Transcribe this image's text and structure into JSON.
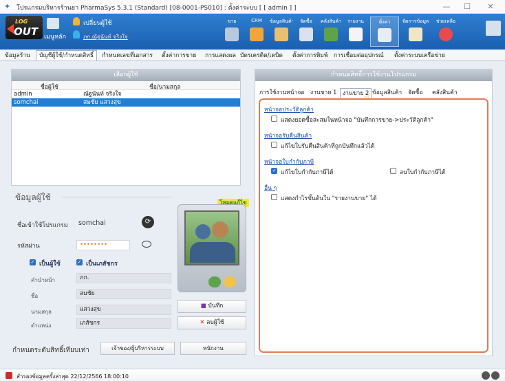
{
  "window": {
    "title": "โปรแกรมบริหารร้านยา PharmaSys 5.3.1 (Standard) [08-0001-PS010] : ตั้งค่าระบบ [ [ admin ] ]"
  },
  "toolbar": {
    "logo_top": "LOG",
    "logo_bottom": "OUT",
    "main_menu": "เมนูหลัก",
    "switch_user": "เปลี่ยนผู้ใช้",
    "user_name": "ภก.ณัฐนันท์ จริงใจ",
    "buttons": [
      "ขาย",
      "CRM",
      "ข้อมูลสินค้า",
      "จัดซื้อ",
      "คลังสินค้า",
      "รายงาน",
      "ตั้งค่า",
      "จัดการข้อมูล",
      "ช่วยเหลือ"
    ]
  },
  "menubar": {
    "items": [
      "ข้อมูลร้าน",
      "บัญชีผู้ใช้/กำหนดสิทธิ์",
      "กำหนดเลขที่เอกสาร",
      "ตั้งค่าการขาย",
      "การแสดงผล",
      "บัตรเครดิต/เดบิต",
      "ตั้งค่าการพิมพ์",
      "การเชื่อมต่ออุปกรณ์",
      "ตั้งค่าระบบเครือข่าย"
    ]
  },
  "userlist": {
    "title": "เลือกผู้ใช้",
    "col_user": "ชื่อผู้ใช้",
    "col_name": "ชื่อ/นามสกุล",
    "rows": [
      {
        "user": "admin",
        "name": "ณัฐนันท์ จริงใจ"
      },
      {
        "user": "somchai",
        "name": "สมชัย แสวงสุข"
      }
    ]
  },
  "userinfo": {
    "title": "ข้อมูลผู้ใช้",
    "edit_mode": "โหมดแก้ไข",
    "login_label": "ชื่อเข้าใช้โปรแกรม",
    "login_value": "somchai",
    "password_label": "รหัสผ่าน",
    "password_value": "••••••••",
    "is_user": "เป็นผู้ใช้",
    "is_pharmacist": "เป็นเภสัชกร",
    "prefix_label": "คำนำหน้า",
    "prefix_value": "ภก.",
    "first_label": "ชื่อ",
    "first_value": "สมชัย",
    "last_label": "นามสกุล",
    "last_value": "แสวงสุข",
    "position_label": "ตำแหน่ง",
    "position_value": "เภสัชกร",
    "save": "บันทึก",
    "delete": "ลบผู้ใช้",
    "level_label": "กำหนดระดับสิทธิ์เทียบเท่า",
    "level_owner": "เจ้าของ/ผู้บริหารระบบ",
    "level_staff": "พนักงาน"
  },
  "rightpanel": {
    "title": "กำหนดสิทธิ์การใช้งานโปรแกรม",
    "tabs": [
      "การใช้งานหน้าจอ",
      "งานขาย 1",
      "งานขาย 2",
      "ข้อมูลสินค้า",
      "จัดซื้อ",
      "คลังสินค้า"
    ],
    "sections": [
      {
        "head": "หน้าจอประวัติลูกค้า",
        "opts": [
          {
            "label": "แสดงยอดซื้อสะสมในหน้าจอ \"บันทึกการขาย->ประวัติลูกค้า\"",
            "checked": false
          }
        ]
      },
      {
        "head": "หน้าจอรับคืนสินค้า",
        "opts": [
          {
            "label": "แก้ไขใบรับคืนสินค้าที่ถูกบันทึกแล้วได้",
            "checked": false
          }
        ]
      },
      {
        "head": "หน้าจอใบกำกับภาษี",
        "opts": [
          {
            "label": "แก้ไขใบกำกับภาษีได้",
            "checked": true
          },
          {
            "label": "ลบใบกำกับภาษีได้",
            "checked": false
          }
        ]
      },
      {
        "head": "อื่น ๆ",
        "opts": [
          {
            "label": "แสดงกำไรขั้นต้นใน \"รายงานขาย\" ได้",
            "checked": false
          }
        ]
      }
    ]
  },
  "statusbar": {
    "text": "สำรองข้อมูลครั้งล่าสุด 22/12/2566 18:00:10"
  },
  "colors": {
    "accent": "#1f7fd8",
    "highlight_border": "#e07a58",
    "toolbar": "#2a6fc4"
  }
}
